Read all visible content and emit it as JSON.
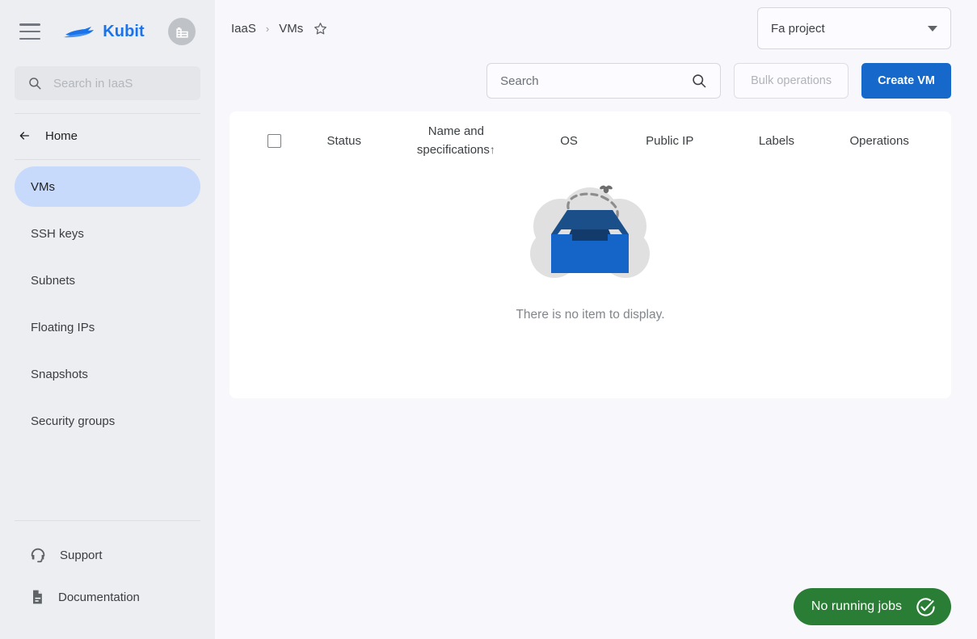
{
  "sidebar": {
    "brand_name": "Kubit",
    "hamburger_icon": "hamburger-menu-icon",
    "org_icon": "building-icon",
    "search_placeholder": "Search in IaaS",
    "search_icon": "search-icon",
    "back_icon": "arrow-left-icon",
    "home_label": "Home",
    "items": [
      {
        "label": "VMs",
        "active": true
      },
      {
        "label": "SSH keys",
        "active": false
      },
      {
        "label": "Subnets",
        "active": false
      },
      {
        "label": "Floating IPs",
        "active": false
      },
      {
        "label": "Snapshots",
        "active": false
      },
      {
        "label": "Security groups",
        "active": false
      }
    ],
    "bottom_items": [
      {
        "label": "Support",
        "icon": "headset-icon"
      },
      {
        "label": "Documentation",
        "icon": "document-icon"
      }
    ]
  },
  "header": {
    "breadcrumb": {
      "root": "IaaS",
      "separator": "›",
      "current": "VMs"
    },
    "favorite_icon": "star-outline-icon",
    "project": {
      "name": "Fa project",
      "chevron_icon": "chevron-down-icon"
    }
  },
  "toolbar": {
    "search_value": "",
    "search_placeholder": "Search",
    "search_icon": "search-icon",
    "bulk_label": "Bulk operations",
    "bulk_disabled": true,
    "create_label": "Create VM"
  },
  "table": {
    "select_all_icon": "checkbox-unchecked-icon",
    "columns": [
      {
        "label": "Status"
      },
      {
        "label": "Name and specifications",
        "sort": "↑"
      },
      {
        "label": "OS"
      },
      {
        "label": "Public IP"
      },
      {
        "label": "Labels"
      },
      {
        "label": "Operations"
      }
    ],
    "empty_message": "There is no item to display.",
    "empty_illustration": "empty-box-icon"
  },
  "toast": {
    "text": "No running jobs",
    "icon": "check-circle-icon",
    "color": "#2a7d34"
  },
  "colors": {
    "accent": "#1669ca",
    "brand": "#1a73e8",
    "active_nav": "#c8dafc",
    "sidebar_bg": "#eceef2",
    "main_bg": "#f8f7fc",
    "card_bg": "#ffffff",
    "success": "#2a7d34"
  }
}
